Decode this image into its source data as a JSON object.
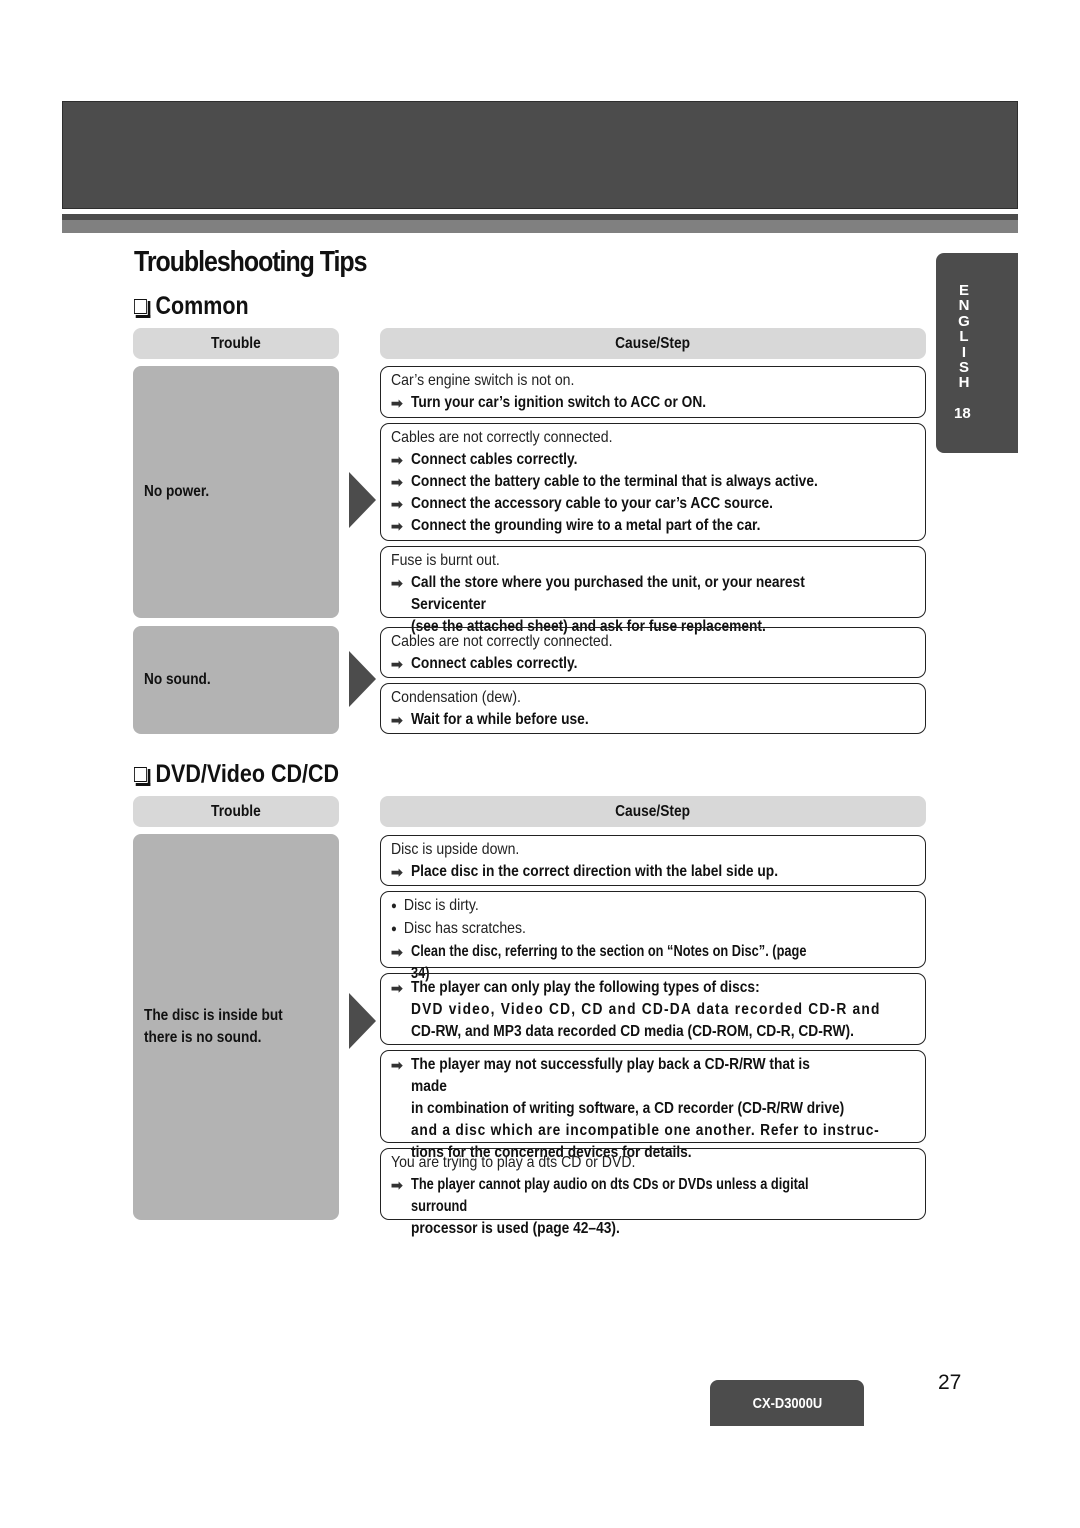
{
  "page": {
    "title": "Troubleshooting Tips",
    "page_number": "27",
    "model": "CX-D3000U",
    "side_tab": {
      "language_letters": [
        "E",
        "N",
        "G",
        "L",
        "I",
        "S",
        "H"
      ],
      "section_number": "18"
    },
    "colors": {
      "dark_band": "#4c4c4c",
      "stripe": "#808080",
      "trouble_fill": "#b3b3b3",
      "header_fill": "#d8d8d8"
    },
    "arrow_glyph": "➡"
  },
  "sections": [
    {
      "title": "Common",
      "headers": {
        "trouble": "Trouble",
        "cause": "Cause/Step"
      },
      "troubles": [
        {
          "label": "No power.",
          "causes": [
            {
              "cause": [
                "Car’s engine switch is not on."
              ],
              "steps": [
                [
                  "Turn your car’s ignition switch to ACC or ON."
                ]
              ]
            },
            {
              "cause": [
                "Cables are not correctly connected."
              ],
              "steps": [
                [
                  "Connect cables correctly."
                ],
                [
                  "Connect the battery cable to the terminal that is always active."
                ],
                [
                  "Connect the accessory cable to your car’s ACC source."
                ],
                [
                  "Connect the grounding wire to a metal part of the car."
                ]
              ]
            },
            {
              "cause": [
                "Fuse is burnt out."
              ],
              "steps": [
                [
                  "Call the store where you purchased the unit, or your nearest Servicenter",
                  "(see the attached sheet) and ask for fuse replacement."
                ]
              ]
            }
          ]
        },
        {
          "label": "No sound.",
          "causes": [
            {
              "cause": [
                "Cables are not correctly connected."
              ],
              "steps": [
                [
                  "Connect cables correctly."
                ]
              ]
            },
            {
              "cause": [
                "Condensation (dew)."
              ],
              "steps": [
                [
                  "Wait for a while before use."
                ]
              ]
            }
          ]
        }
      ]
    },
    {
      "title": "DVD/Video CD/CD",
      "headers": {
        "trouble": "Trouble",
        "cause": "Cause/Step"
      },
      "troubles": [
        {
          "label": "The disc is inside but there is no sound.",
          "causes": [
            {
              "cause": [
                "Disc is upside down."
              ],
              "steps": [
                [
                  "Place disc in the correct direction with the label side up."
                ]
              ]
            },
            {
              "bullets": [
                "Disc is dirty.",
                "Disc has scratches."
              ],
              "steps": [
                [
                  "Clean the disc, referring to the section on “Notes on Disc”. (page 34)"
                ]
              ]
            },
            {
              "steps": [
                [
                  "The player can only play the following types of discs:",
                  "DVD video, Video CD, CD and CD-DA data recorded CD-R and",
                  "CD-RW, and MP3 data recorded CD media (CD-ROM, CD-R, CD-RW)."
                ]
              ]
            },
            {
              "steps": [
                [
                  "The player may not successfully play back a CD-R/RW that is made",
                  "in combination of writing software, a CD recorder (CD-R/RW drive)",
                  "and a disc which are incompatible one another. Refer to instruc-",
                  "tions for the concerned devices for details."
                ]
              ]
            },
            {
              "cause": [
                "You are trying to play a dts CD or DVD."
              ],
              "steps": [
                [
                  "The player cannot play audio on dts CDs or DVDs unless a digital surround",
                  "processor is used (page 42–43)."
                ]
              ]
            }
          ]
        }
      ]
    }
  ]
}
